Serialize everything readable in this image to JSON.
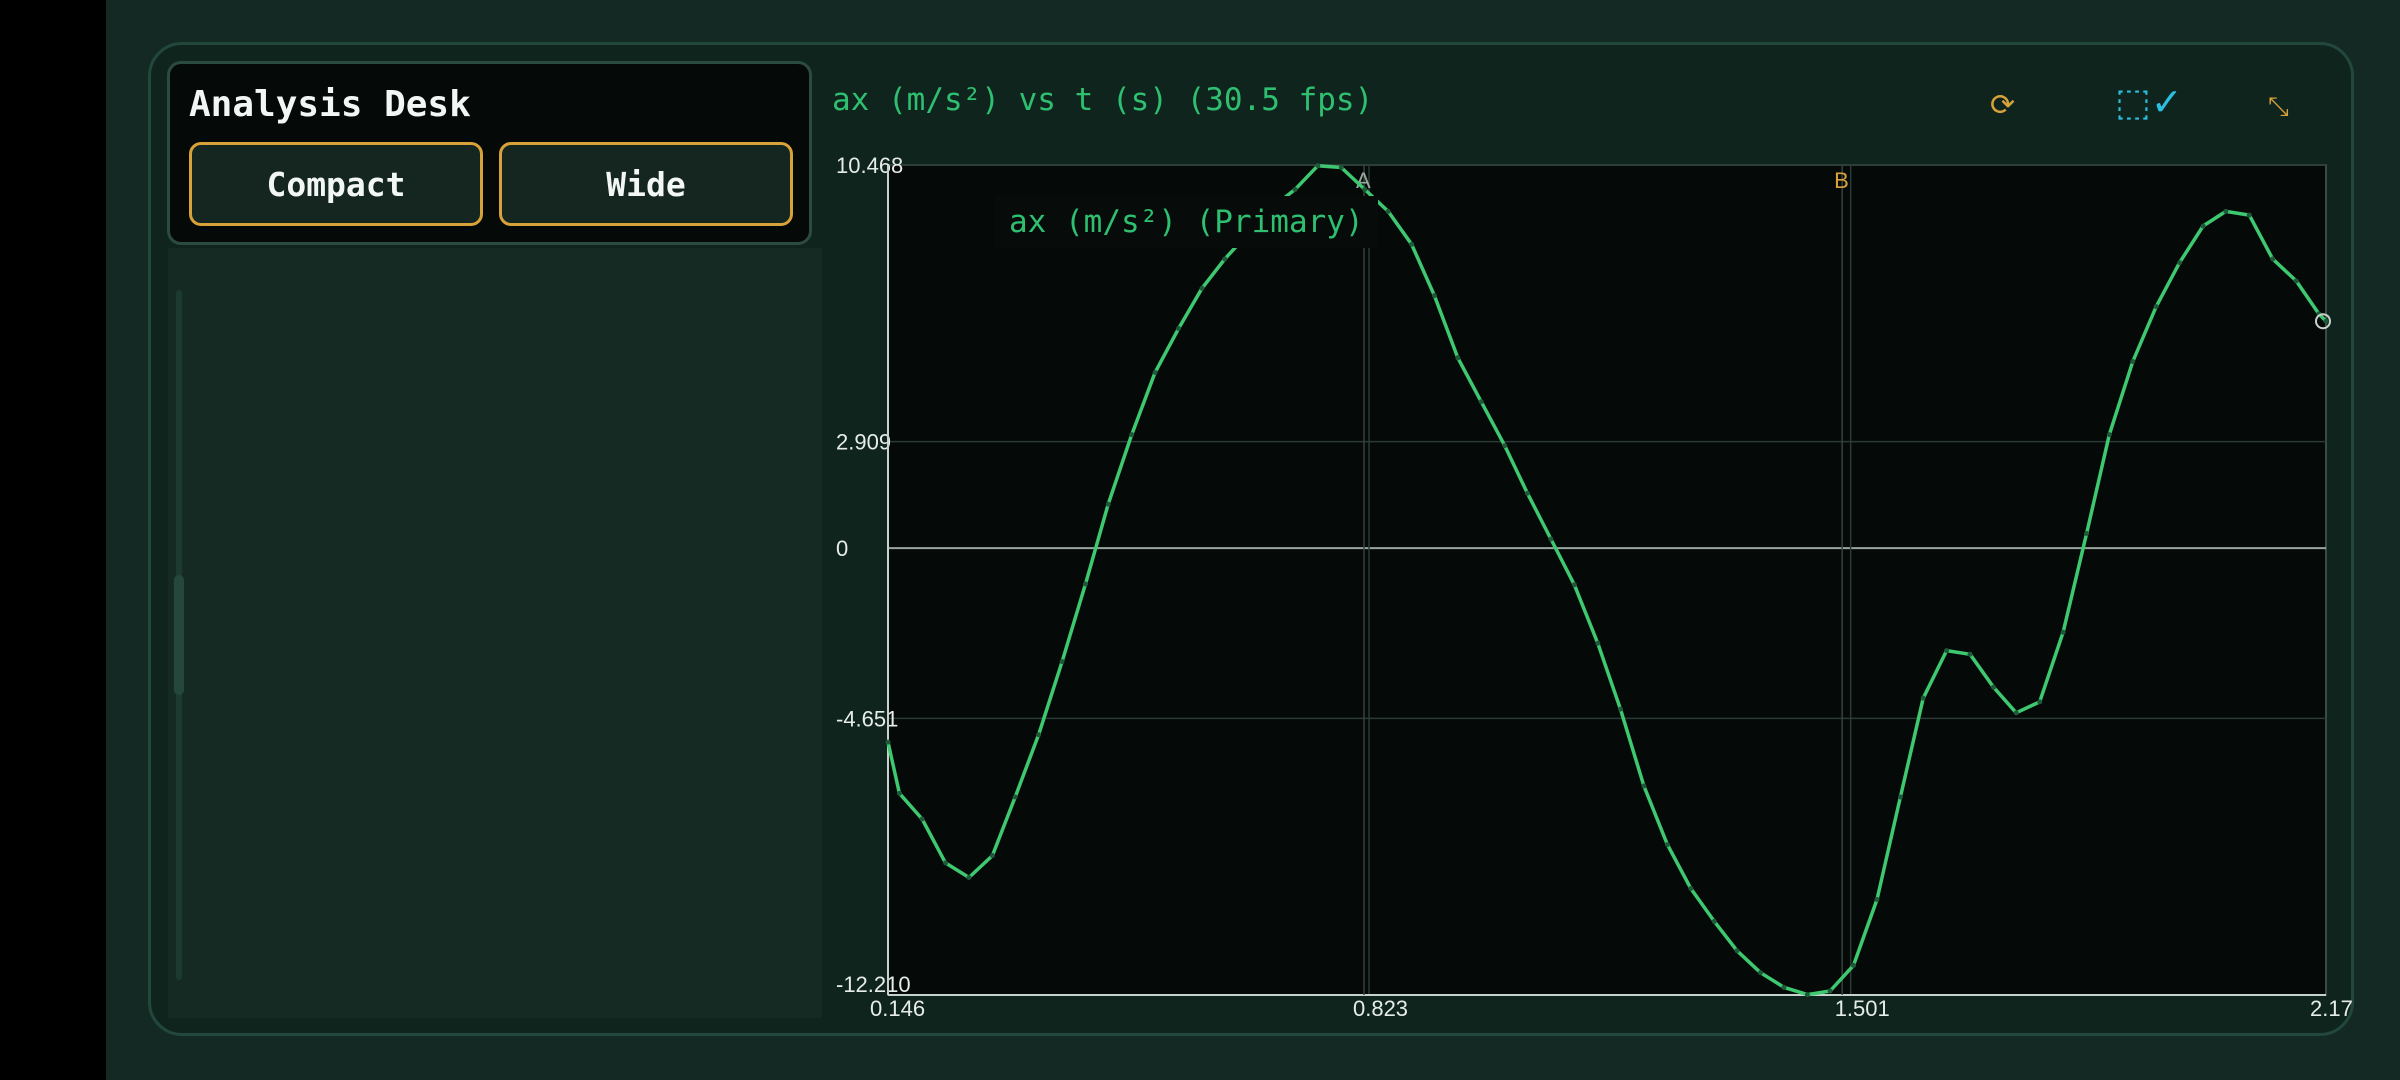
{
  "panel": {
    "title": "Analysis Desk",
    "buttons": [
      "Compact",
      "Wide"
    ]
  },
  "chart_header": {
    "title": "ax (m/s²) vs t (s) (30.5 fps)",
    "tools": [
      {
        "name": "refresh-icon",
        "glyph": "⟳",
        "color": "#d8a13a"
      },
      {
        "name": "select-check-icon",
        "glyph": "⬚✓",
        "color": "#2bbfe0"
      },
      {
        "name": "expand-icon",
        "glyph": "⤡",
        "color": "#d8a13a"
      }
    ]
  },
  "chart_data": {
    "type": "line",
    "title": "ax (m/s²) vs t (s) (30.5 fps)",
    "xlabel": "t (s)",
    "ylabel": "ax (m/s²)",
    "xlim": [
      0.146,
      2.17
    ],
    "ylim": [
      -12.21,
      10.468
    ],
    "xticks": [
      "0.146",
      "0.823",
      "1.501",
      "2.17"
    ],
    "yticks": [
      "10.468",
      "2.909",
      "0",
      "-4.651",
      "-12.210"
    ],
    "xtick_values": [
      0.146,
      0.823,
      1.501,
      2.17
    ],
    "ytick_values": [
      10.468,
      2.909,
      0,
      -4.651,
      -12.21
    ],
    "markers": [
      {
        "label": "A",
        "t": 0.816,
        "color": "#9aa6a0"
      },
      {
        "label": "B",
        "t": 1.489,
        "color": "#d8a13a"
      }
    ],
    "grid": true,
    "legend": "top-left",
    "series": [
      {
        "name": "ax (m/s²) (Primary)",
        "color": "#3ec86f",
        "x": [
          0.146,
          0.162,
          0.194,
          0.227,
          0.26,
          0.293,
          0.325,
          0.358,
          0.391,
          0.424,
          0.456,
          0.489,
          0.522,
          0.555,
          0.588,
          0.62,
          0.653,
          0.686,
          0.719,
          0.751,
          0.784,
          0.817,
          0.85,
          0.883,
          0.915,
          0.948,
          0.981,
          1.014,
          1.046,
          1.079,
          1.112,
          1.145,
          1.177,
          1.21,
          1.243,
          1.276,
          1.309,
          1.341,
          1.374,
          1.407,
          1.44,
          1.472,
          1.505,
          1.538,
          1.571,
          1.603,
          1.636,
          1.669,
          1.702,
          1.734,
          1.767,
          1.8,
          1.833,
          1.865,
          1.898,
          1.931,
          1.964,
          1.997,
          2.029,
          2.062,
          2.095,
          2.128,
          2.16,
          2.17
        ],
        "values": [
          -5.3,
          -6.7,
          -7.4,
          -8.6,
          -9.0,
          -8.4,
          -6.8,
          -5.1,
          -3.1,
          -0.98,
          1.2,
          3.1,
          4.8,
          6.0,
          7.1,
          7.9,
          8.6,
          9.3,
          9.8,
          10.45,
          10.4,
          9.8,
          9.2,
          8.3,
          6.9,
          5.2,
          4.0,
          2.8,
          1.5,
          0.25,
          -1.0,
          -2.6,
          -4.4,
          -6.5,
          -8.1,
          -9.3,
          -10.2,
          -11.0,
          -11.6,
          -12.0,
          -12.2,
          -12.1,
          -11.4,
          -9.6,
          -6.8,
          -4.1,
          -2.8,
          -2.9,
          -3.8,
          -4.5,
          -4.2,
          -2.3,
          0.4,
          3.1,
          5.1,
          6.6,
          7.8,
          8.8,
          9.2,
          9.1,
          7.9,
          7.3,
          6.4,
          6.2
        ]
      }
    ]
  }
}
